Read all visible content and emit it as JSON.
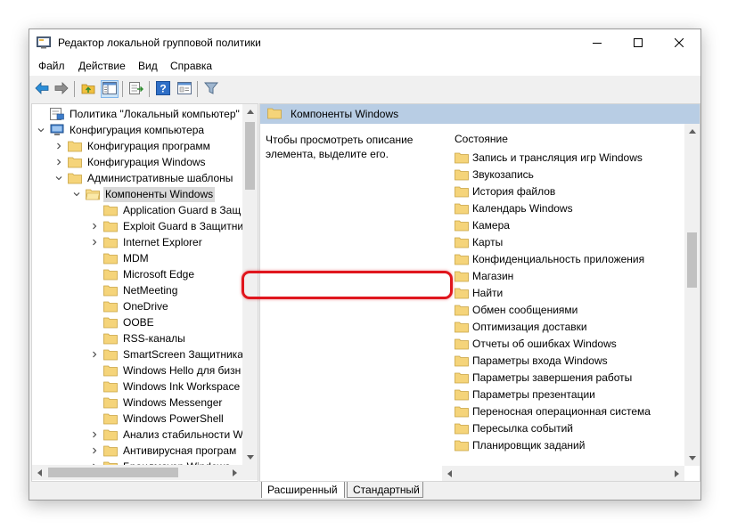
{
  "window": {
    "title": "Редактор локальной групповой политики",
    "app_icon": "gpedit-icon"
  },
  "menu": [
    {
      "label": "Файл"
    },
    {
      "label": "Действие"
    },
    {
      "label": "Вид"
    },
    {
      "label": "Справка"
    }
  ],
  "toolbar": {
    "buttons": [
      "back-arrow-icon",
      "forward-arrow-icon",
      "up-folder-icon",
      "show-hide-tree-icon",
      "export-list-icon",
      "help-icon",
      "properties-icon",
      "filter-icon"
    ]
  },
  "tree": {
    "items": [
      {
        "label": "Политика \"Локальный компьютер\"",
        "icon": "computer-policy-icon"
      },
      {
        "label": "Конфигурация компьютера",
        "icon": "computer-icon"
      },
      {
        "label": "Конфигурация программ",
        "icon": "folder-icon"
      },
      {
        "label": "Конфигурация Windows",
        "icon": "folder-icon"
      },
      {
        "label": "Административные шаблоны",
        "icon": "folder-icon"
      },
      {
        "label": "Компоненты Windows",
        "icon": "folder-open-icon"
      },
      {
        "label": "Application Guard в Защ",
        "icon": "folder-icon"
      },
      {
        "label": "Exploit Guard в Защитни",
        "icon": "folder-icon"
      },
      {
        "label": "Internet Explorer",
        "icon": "folder-icon"
      },
      {
        "label": "MDM",
        "icon": "folder-icon"
      },
      {
        "label": "Microsoft Edge",
        "icon": "folder-icon"
      },
      {
        "label": "NetMeeting",
        "icon": "folder-icon"
      },
      {
        "label": "OneDrive",
        "icon": "folder-icon"
      },
      {
        "label": "OOBE",
        "icon": "folder-icon"
      },
      {
        "label": "RSS-каналы",
        "icon": "folder-icon"
      },
      {
        "label": "SmartScreen Защитника",
        "icon": "folder-icon"
      },
      {
        "label": "Windows Hello для бизн",
        "icon": "folder-icon"
      },
      {
        "label": "Windows Ink Workspace",
        "icon": "folder-icon"
      },
      {
        "label": "Windows Messenger",
        "icon": "folder-icon"
      },
      {
        "label": "Windows PowerShell",
        "icon": "folder-icon"
      },
      {
        "label": "Анализ стабильности W",
        "icon": "folder-icon"
      },
      {
        "label": "Антивирусная програм",
        "icon": "folder-icon"
      },
      {
        "label": "Брандмауэр Windows",
        "icon": "folder-icon"
      }
    ]
  },
  "details": {
    "header": "Компоненты Windows",
    "description": "Чтобы просмотреть описание элемента, выделите его.",
    "column": "Состояние",
    "items": [
      "Запись и трансляция игр Windows",
      "Звукозапись",
      "История файлов",
      "Календарь Windows",
      "Камера",
      "Карты",
      "Конфиденциальность приложения",
      "Магазин",
      "Найти",
      "Обмен сообщениями",
      "Оптимизация доставки",
      "Отчеты об ошибках Windows",
      "Параметры входа Windows",
      "Параметры завершения работы",
      "Параметры презентации",
      "Переносная операционная система",
      "Пересылка событий",
      "Планировщик заданий"
    ],
    "highlighted": "Конфиденциальность приложения"
  },
  "tabs": [
    {
      "label": "Расширенный",
      "active": true
    },
    {
      "label": "Стандартный",
      "active": false
    }
  ],
  "colors": {
    "highlight": "#e0161d",
    "folder": "#f5d47a",
    "header_bg": "#b8cde4"
  }
}
